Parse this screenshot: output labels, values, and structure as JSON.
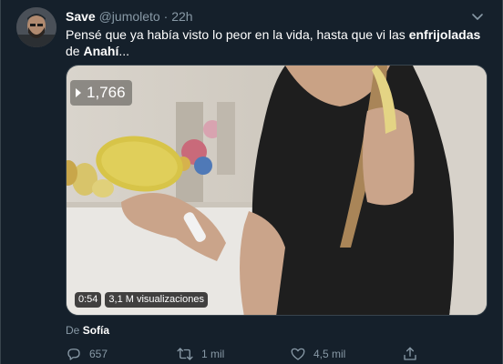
{
  "tweet": {
    "author": {
      "display_name": "Save",
      "handle": "@jumoleto",
      "separator": "·",
      "time": "22h"
    },
    "text": {
      "part1": "Pensé que ya había visto lo peor en la vida, hasta que vi las ",
      "bold1": "enfrijoladas",
      "part2": " de ",
      "bold2": "Anahí",
      "part3": "..."
    },
    "media": {
      "view_count": "1,766",
      "duration": "0:54",
      "views_label": "3,1 M visualizaciones"
    },
    "source": {
      "prefix": "De",
      "name": "Sofía"
    },
    "actions": {
      "reply_count": "657",
      "retweet_count": "1 mil",
      "like_count": "4,5 mil"
    }
  },
  "colors": {
    "background": "#15202b",
    "muted_text": "#8899a6",
    "border": "#38444d"
  },
  "icons": [
    "caret-down-icon",
    "eye-icon",
    "reply-icon",
    "retweet-icon",
    "like-icon",
    "share-icon"
  ]
}
